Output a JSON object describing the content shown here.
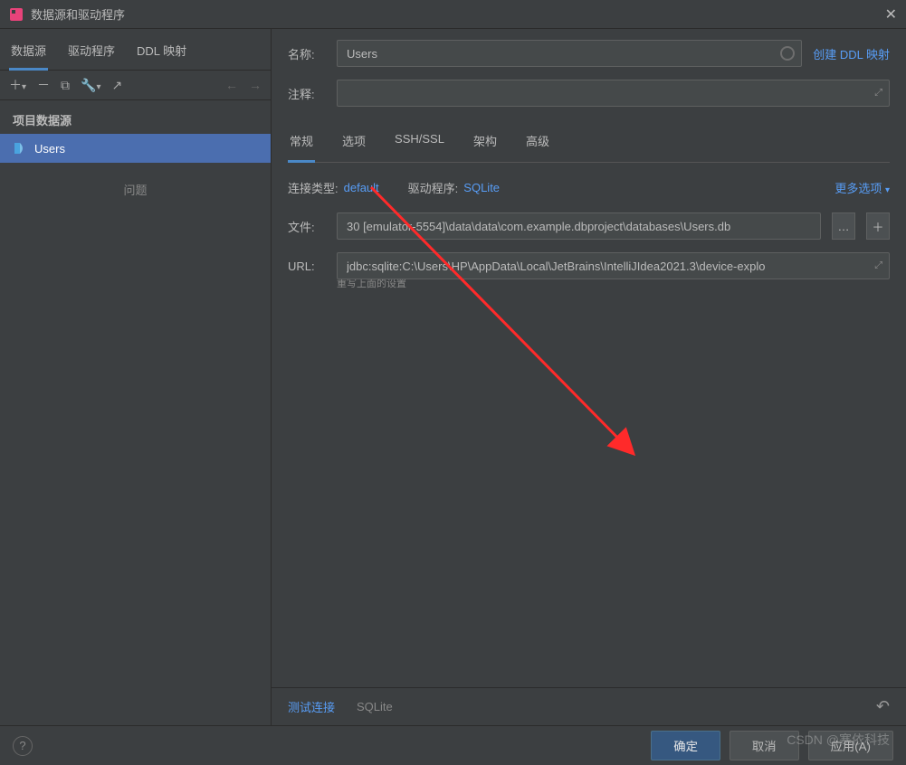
{
  "window": {
    "title": "数据源和驱动程序"
  },
  "sidebar": {
    "tabs": [
      "数据源",
      "驱动程序",
      "DDL 映射"
    ],
    "activeTab": 0,
    "section_label": "项目数据源",
    "items": [
      {
        "label": "Users",
        "selected": true
      }
    ],
    "plain_label": "问题"
  },
  "form": {
    "name_label": "名称:",
    "name_value": "Users",
    "create_ddl_link": "创建 DDL 映射",
    "comment_label": "注释:",
    "comment_value": ""
  },
  "content_tabs": [
    "常规",
    "选项",
    "SSH/SSL",
    "架构",
    "高级"
  ],
  "content_active_tab": 0,
  "meta": {
    "conn_type_label": "连接类型:",
    "conn_type_value": "default",
    "driver_label": "驱动程序:",
    "driver_value": "SQLite",
    "more_options": "更多选项"
  },
  "file": {
    "label": "文件:",
    "value": "30 [emulator-5554]\\data\\data\\com.example.dbproject\\databases\\Users.db"
  },
  "url": {
    "label": "URL:",
    "value": "jdbc:sqlite:C:\\Users\\HP\\AppData\\Local\\JetBrains\\IntelliJIdea2021.3\\device-explo",
    "note": "重写上面的设置"
  },
  "status": {
    "test_connection": "测试连接",
    "driver_name": "SQLite"
  },
  "footer": {
    "ok": "确定",
    "cancel": "取消",
    "apply": "应用(A)"
  },
  "watermark": "CSDN @寒依科技"
}
